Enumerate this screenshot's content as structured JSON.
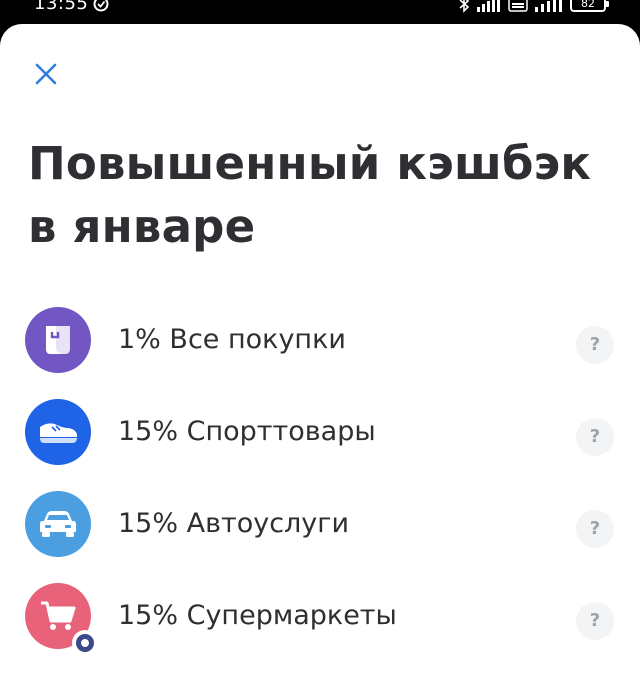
{
  "status_bar": {
    "time": "13:55",
    "battery": "82"
  },
  "header": {
    "title": "Повышенный кэшбэк в январе"
  },
  "cashback": {
    "items": [
      {
        "label": "1% Все покупки",
        "icon": "shopping-bag-icon",
        "color": "#7257c4",
        "info": "?"
      },
      {
        "label": "15% Спорттовары",
        "icon": "sneaker-icon",
        "color": "#1f63e6",
        "info": "?"
      },
      {
        "label": "15% Автоуслуги",
        "icon": "car-icon",
        "color": "#4b9fe0",
        "info": "?"
      },
      {
        "label": "15% Супермаркеты",
        "icon": "shopping-cart-icon",
        "color": "#e8627a",
        "info": "?"
      }
    ]
  },
  "colors": {
    "close_icon": "#2f7de1",
    "text": "#2f2f33",
    "info_bg": "#f3f4f6",
    "info_text": "#9ea3aa"
  }
}
